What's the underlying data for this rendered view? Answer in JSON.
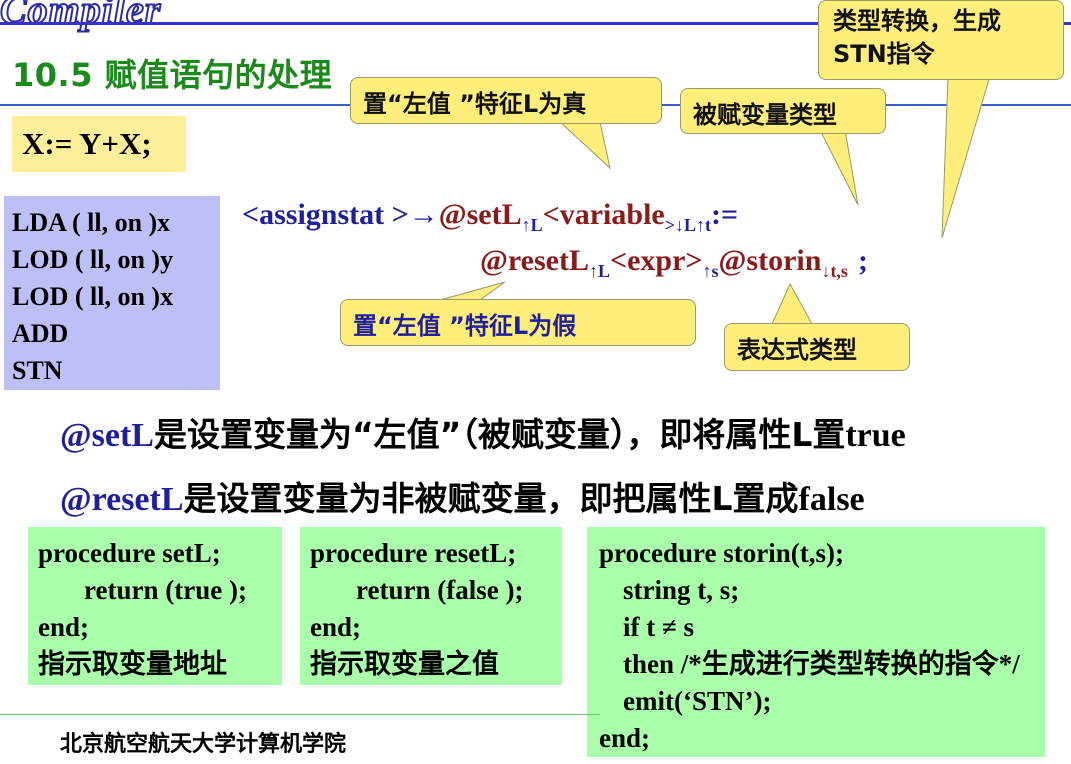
{
  "header": {
    "logo_text": "Compiler",
    "section_title": "10.5 赋值语句的处理"
  },
  "statement": "X:= Y+X;",
  "code_lines": [
    "LDA  ( ll, on )x",
    "LOD  ( ll, on )y",
    "LOD  ( ll, on )x",
    "ADD",
    "STN"
  ],
  "callouts": {
    "stn": [
      "类型转换，生成",
      "STN指令"
    ],
    "set_true": "置“左值 ”特征L为真",
    "var_type": "被赋变量类型",
    "set_false": "置“左值 ”特征L为假",
    "expr_type": "表达式类型"
  },
  "production": {
    "p1": "<assignstat >→",
    "p2": "@setL",
    "p2_sub": "↑L",
    "p3": "<variable",
    "p3_sub": ">↓L↑t",
    "p4": ":=",
    "p5": "@resetL",
    "p5_sub": "↑L",
    "p6": "<expr>",
    "p6_sub": "↑s",
    "p7": "@storin",
    "p7_sub": "↓t,s",
    "p8": ";"
  },
  "descriptions": {
    "d1_kw": "@setL",
    "d1_text": "是设置变量为“左值”（被赋变量），即将属性L置",
    "d1_tail": "true",
    "d2_kw": "@resetL",
    "d2_text": "是设置变量为非被赋变量，即把属性L置成",
    "d2_tail": "false"
  },
  "procedures": {
    "setL": [
      "procedure setL;",
      "return (true );",
      "end;",
      "指示取变量地址"
    ],
    "resetL": [
      "procedure resetL;",
      "return (false );",
      "end;",
      "指示取变量之值"
    ],
    "storin": [
      "procedure storin(t,s);",
      "string t, s;",
      "if t ≠ s",
      "then /*生成进行类型转换的指令*/",
      "emit(‘STN’);",
      "end;"
    ]
  },
  "footer": "北京航空航天大学计算机学院",
  "colors": {
    "callout_bg": "#ffef7a",
    "code_bg": "#bfbff7",
    "proc_bg": "#aaffaa",
    "title_green": "#1a8a1a",
    "production_blue": "#1f1f9e",
    "production_red": "#8b1a1a"
  }
}
